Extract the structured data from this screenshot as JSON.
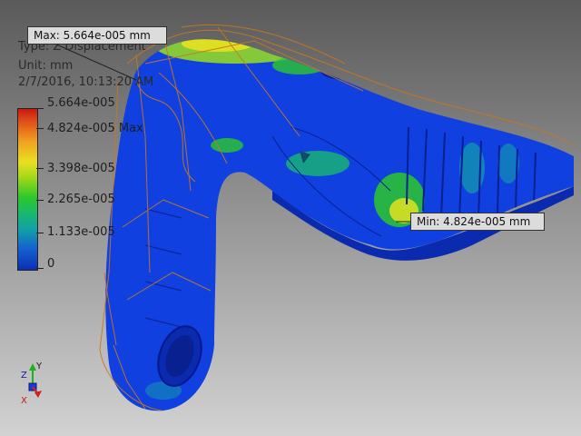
{
  "result": {
    "type_label": "Type: Z Displacement",
    "unit_label": "Unit: mm",
    "date_label": "2/7/2016, 10:13:20 AM"
  },
  "legend": {
    "ticks": [
      "5.664e-005",
      "4.824e-005 Max",
      "3.398e-005",
      "2.265e-005",
      "1.133e-005",
      "0"
    ],
    "colors": [
      "#c81a10",
      "#f0a020",
      "#e8e020",
      "#2cc82a",
      "#12a0a8",
      "#0a2fb4"
    ]
  },
  "probes": {
    "max_label": "Max: 5.664e-005 mm",
    "min_label": "Min: 4.824e-005 mm"
  },
  "triad": {
    "z_label": "Z",
    "y_label": "Y",
    "x_label": "X"
  },
  "colors": {
    "mesh_blue": "#1040e0",
    "wireframe": "#c8781e",
    "background_top": "#5a5a5a",
    "background_bottom": "#d2d2d2"
  }
}
